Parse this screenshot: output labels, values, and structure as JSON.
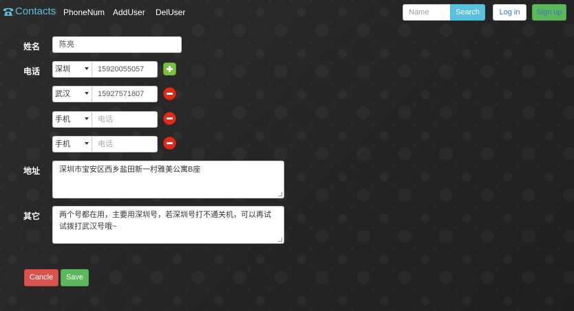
{
  "navbar": {
    "brand": "Contacts",
    "links": [
      "PhoneNum",
      "AddUser",
      "DelUser"
    ],
    "search_placeholder": "Name",
    "search_label": "Search",
    "login_label": "Log in",
    "signup_label": "Sign up"
  },
  "form": {
    "name_label": "姓名",
    "name_value": "陈亮",
    "phone_label": "电话",
    "phones": [
      {
        "location": "深圳",
        "number": "15920055057",
        "action": "add"
      },
      {
        "location": "武汉",
        "number": "15927571807",
        "action": "remove"
      },
      {
        "location": "手机",
        "number": "",
        "placeholder": "电话",
        "action": "remove"
      },
      {
        "location": "手机",
        "number": "",
        "placeholder": "电话",
        "action": "remove"
      }
    ],
    "address_label": "地址",
    "address_value": "深圳市宝安区西乡盐田新一村雅美公寓B座",
    "other_label": "其它",
    "other_value": "两个号都在用，主要用深圳号，若深圳号打不通关机，可以再试试拨打武汉号哦~",
    "cancel_label": "Cancle",
    "save_label": "Save"
  },
  "colors": {
    "brand": "#5bc0de",
    "info": "#5bc0de",
    "success": "#5cb85c",
    "danger": "#d9534f",
    "add_icon": "#7ac142",
    "remove_icon": "#e02d1a"
  },
  "icons": {
    "brand": "phone-icon",
    "add": "plus-icon",
    "remove": "minus-icon",
    "dropdown": "caret-down-icon"
  }
}
